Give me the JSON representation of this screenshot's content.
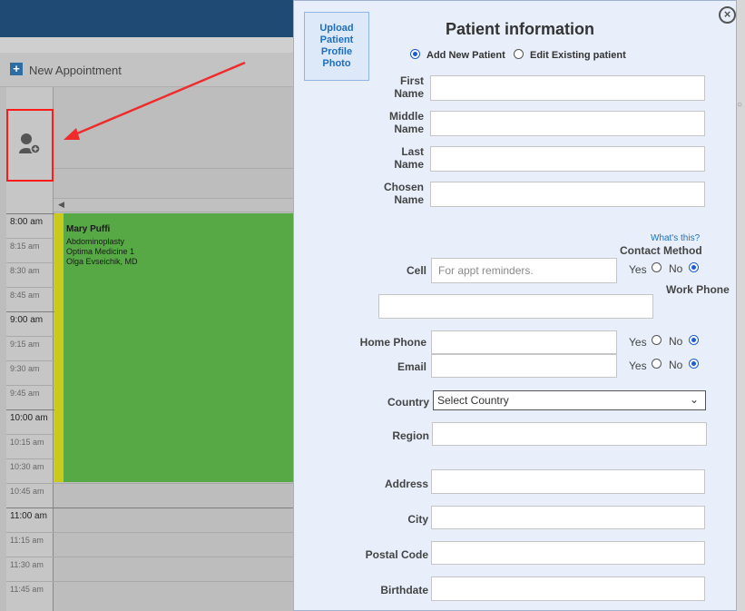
{
  "app": {
    "new_appointment_label": "New Appointment",
    "plus_symbol": "+"
  },
  "calendar": {
    "times": [
      {
        "label": "8:00 am",
        "hour": true
      },
      {
        "label": "8:15 am",
        "hour": false
      },
      {
        "label": "8:30 am",
        "hour": false
      },
      {
        "label": "8:45 am",
        "hour": false
      },
      {
        "label": "9:00 am",
        "hour": true
      },
      {
        "label": "9:15 am",
        "hour": false
      },
      {
        "label": "9:30 am",
        "hour": false
      },
      {
        "label": "9:45 am",
        "hour": false
      },
      {
        "label": "10:00 am",
        "hour": true
      },
      {
        "label": "10:15 am",
        "hour": false
      },
      {
        "label": "10:30 am",
        "hour": false
      },
      {
        "label": "10:45 am",
        "hour": false
      },
      {
        "label": "11:00 am",
        "hour": true
      },
      {
        "label": "11:15 am",
        "hour": false
      },
      {
        "label": "11:30 am",
        "hour": false
      },
      {
        "label": "11:45 am",
        "hour": false
      }
    ],
    "appointment": {
      "name": "Mary Puffi",
      "procedure": "Abdominoplasty",
      "location": "Optima Medicine 1",
      "provider": "Olga Evseichik, MD"
    },
    "colors": {
      "appointment": "#56a944",
      "marker": "#c9c91e",
      "highlight": "#ff1a1a"
    }
  },
  "modal": {
    "close_symbol": "×",
    "upload_label": "Upload Patient Profile Photo",
    "title": "Patient information",
    "mode_add_label": "Add New Patient",
    "mode_edit_label": "Edit Existing patient",
    "first_name_label": "First Name",
    "middle_name_label": "Middle Name",
    "last_name_label": "Last Name",
    "chosen_name_label": "Chosen Name",
    "whats_this": "What's this?",
    "contact_method_label": "Contact Method",
    "cell_label": "Cell",
    "cell_placeholder": "For appt reminders.",
    "work_phone_label": "Work Phone",
    "home_phone_label": "Home Phone",
    "email_label": "Email",
    "yes_label": "Yes",
    "no_label": "No",
    "country_label": "Country",
    "country_value": "Select Country",
    "region_label": "Region",
    "address_label": "Address",
    "city_label": "City",
    "postal_code_label": "Postal Code",
    "birthdate_label": "Birthdate"
  }
}
